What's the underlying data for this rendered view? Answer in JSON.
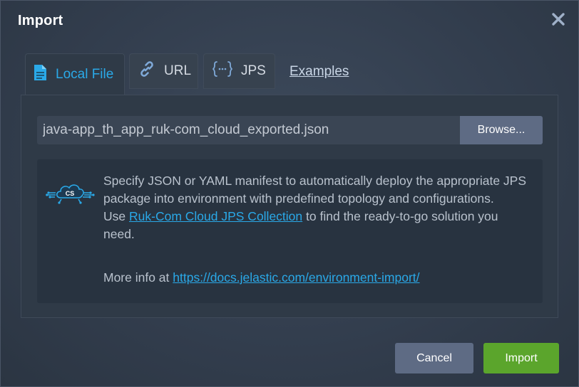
{
  "dialog": {
    "title": "Import",
    "close_icon": "close-icon"
  },
  "tabs": {
    "local_file": "Local File",
    "url": "URL",
    "jps": "JPS",
    "examples": "Examples"
  },
  "local_file": {
    "file_name": "java-app_th_app_ruk-com_cloud_exported.json",
    "browse_label": "Browse..."
  },
  "info": {
    "logo_text": "CS",
    "line1": "Specify JSON or YAML manifest to automatically deploy the appropriate JPS package into environment with predefined topology and configurations.",
    "use_prefix": "Use",
    "collection_link": "Ruk-Com Cloud JPS Collection",
    "use_suffix": "to find the ready-to-go solution you need.",
    "more_prefix": "More info at",
    "more_link": "https://docs.jelastic.com/environment-import/"
  },
  "footer": {
    "cancel_label": "Cancel",
    "import_label": "Import"
  },
  "colors": {
    "accent": "#2aa9e8",
    "primary_button": "#5ba52c",
    "secondary_button": "#5e6b84"
  }
}
